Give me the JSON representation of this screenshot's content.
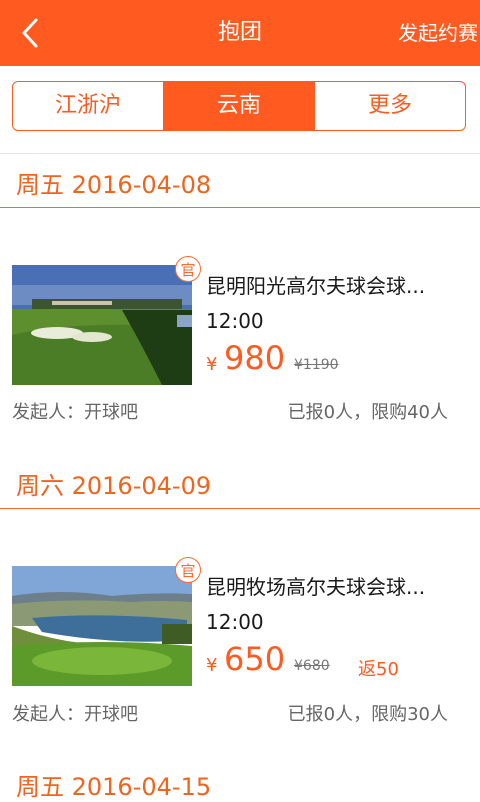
{
  "header": {
    "title": "抱团",
    "action_label": "发起约赛"
  },
  "tabs": [
    {
      "label": "江浙沪",
      "active": false
    },
    {
      "label": "云南",
      "active": true
    },
    {
      "label": "更多",
      "active": false
    }
  ],
  "sections": [
    {
      "date": "周五 2016-04-08",
      "item": {
        "badge": "官",
        "name": "昆明阳光高尔夫球会球...",
        "time": "12:00",
        "currency": "¥",
        "price": "980",
        "original_price": "¥1190",
        "rebate": "",
        "host": "发起人：开球吧",
        "quota": "已报0人，限购40人"
      }
    },
    {
      "date": "周六 2016-04-09",
      "item": {
        "badge": "官",
        "name": "昆明牧场高尔夫球会球...",
        "time": "12:00",
        "currency": "¥",
        "price": "650",
        "original_price": "¥680",
        "rebate": "返50",
        "host": "发起人：开球吧",
        "quota": "已报0人，限购30人"
      }
    },
    {
      "date": "周五 2016-04-15"
    }
  ],
  "colors": {
    "accent": "#ff5a1f",
    "date": "#f0641e"
  }
}
